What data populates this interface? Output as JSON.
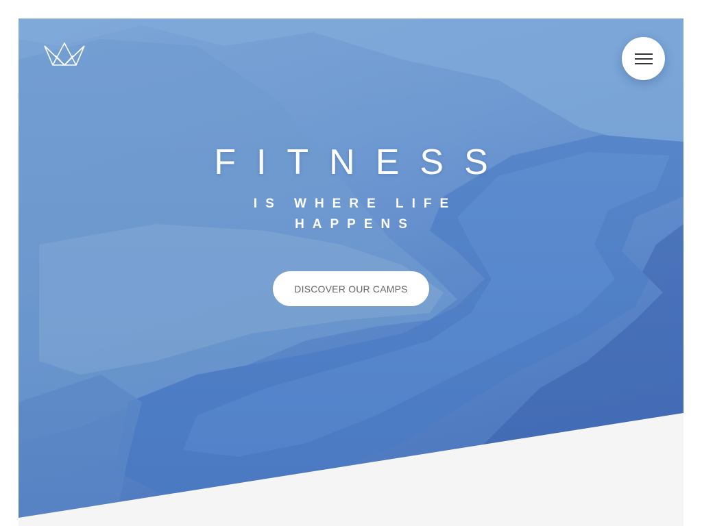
{
  "brand": {
    "logo_icon": "crown-icon"
  },
  "header": {
    "menu_icon": "hamburger-menu-icon"
  },
  "hero": {
    "title": "FITNESS",
    "subtitle": "IS WHERE LIFE HAPPENS",
    "cta_label": "DISCOVER OUR CAMPS"
  },
  "colors": {
    "hero_blue": "#5f8ccc",
    "lake_blue": "#3f6ebc",
    "page_bottom": "#f5f5f5",
    "button_text": "#666666"
  }
}
